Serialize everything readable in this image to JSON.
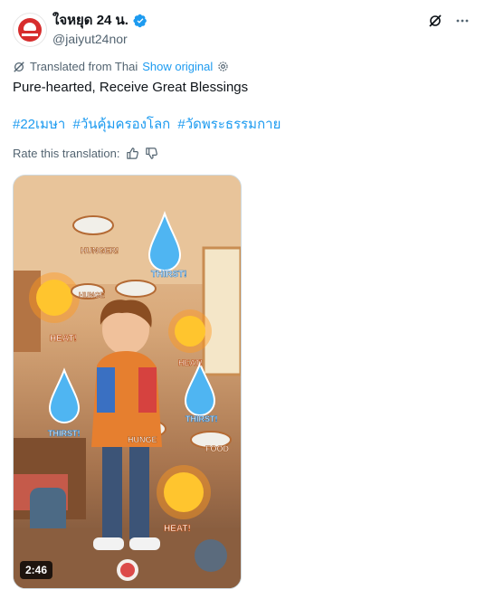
{
  "post": {
    "author_name": "ใจหยุด 24 น.",
    "handle": "@jaiyut24nor",
    "translated_from": "Translated from Thai",
    "show_original": "Show original",
    "text": "Pure-hearted, Receive Great Blessings",
    "hashtags": [
      "#22เมษา",
      "#วันคุ้มครองโลก",
      "#วัดพระธรรมกาย"
    ],
    "rate_translation": "Rate this translation:",
    "video_duration": "2:46"
  },
  "media_labels": {
    "hunger": "HUNGER!",
    "thirst": "THIRST!",
    "heat": "HEAT!",
    "hunger_bowl": "HUNGE",
    "food": "FOOD"
  },
  "icons": {
    "verified": "verified-badge-icon",
    "grok": "grok-icon",
    "more": "more-options-icon",
    "translate": "translate-icon",
    "settings": "gear-icon",
    "thumbs_up": "thumbs-up-icon",
    "thumbs_down": "thumbs-down-icon"
  },
  "colors": {
    "accent": "#1d9bf0",
    "text": "#0f1419",
    "muted": "#536471",
    "logo_red": "#d72d2d"
  }
}
